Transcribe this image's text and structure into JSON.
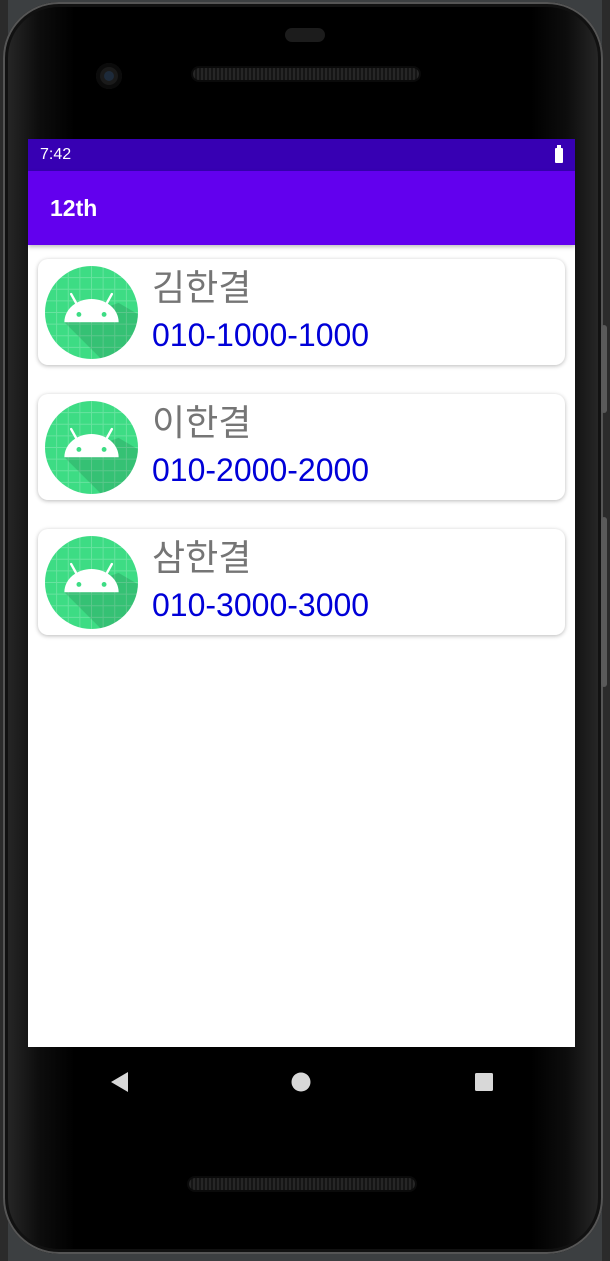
{
  "status_bar": {
    "time": "7:42",
    "battery_icon": "battery-full-icon"
  },
  "app_bar": {
    "title": "12th",
    "background": "#6200ee",
    "status_background": "#3700b3"
  },
  "contacts": [
    {
      "name": "김한결",
      "phone": "010-1000-1000",
      "avatar_icon": "android-icon"
    },
    {
      "name": "이한결",
      "phone": "010-2000-2000",
      "avatar_icon": "android-icon"
    },
    {
      "name": "삼한결",
      "phone": "010-3000-3000",
      "avatar_icon": "android-icon"
    }
  ],
  "navigation": {
    "back_icon": "back-triangle-icon",
    "home_icon": "home-circle-icon",
    "recents_icon": "recents-square-icon"
  },
  "colors": {
    "name_text": "#757575",
    "phone_text": "#0000d8",
    "avatar_green": "#3ddc84"
  }
}
